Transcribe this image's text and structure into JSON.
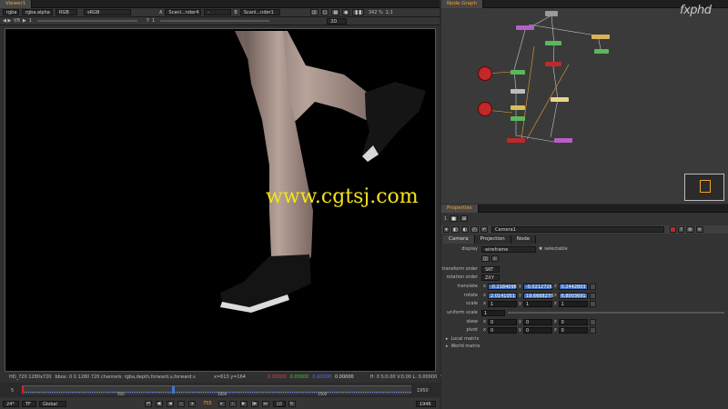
{
  "viewer_tabs": [
    {
      "label": "Viewer1"
    }
  ],
  "nodegraph_tab": {
    "label": "Node Graph"
  },
  "properties_tab": {
    "label": "Properties"
  },
  "watermark_logo": "fxphd",
  "watermark_url": "www.cgtsj.com",
  "viewer_toolbar": {
    "channels": "rgba",
    "alpha": "rgba.alpha",
    "colorspace_mode": "RGB",
    "lut": "sRGB",
    "a_label": "A",
    "a_input": "Scanl...nder4",
    "ab_op": "-",
    "b_label": "B",
    "b_input": "Scanl...nder1",
    "zoom": "342 %",
    "ratio": "1:1"
  },
  "viewer_toolbar2": {
    "fstop": "f/8",
    "frame_field": "1",
    "y_label": "Y",
    "y_value": "1",
    "gain_field": "2D"
  },
  "status_bar": {
    "format": "HD_720 1280x720",
    "bbox": "bbox: 0 0 1280 720 channels: rgba,depth,forward.u,forward.v",
    "coords": "x=613 y=164",
    "r": "0.00000",
    "g": "0.00000",
    "b": "0.00000",
    "a": "0.00000",
    "hsvl": "H: 0 S:0.00 V:0.00  L: 0.00000"
  },
  "timeline": {
    "start": "5",
    "end": "1950",
    "ticks": [
      "500",
      "1000",
      "1500"
    ],
    "fps": "24*",
    "tf": "TF",
    "scope": "Global",
    "current_frame": "755",
    "step": "10",
    "end_field": "1946"
  },
  "properties": {
    "node_name": "Camera1",
    "tabs": [
      "Camera",
      "Projection",
      "Node"
    ],
    "display_label": "display",
    "display_value": "wireframe",
    "selectable_label": "selectable",
    "transform_order_label": "transform order",
    "transform_order_value": "SRT",
    "rotation_order_label": "rotation order",
    "rotation_order_value": "ZXY",
    "translate_label": "translate",
    "translate": {
      "x": "-0.2184098",
      "y": "-0.0212726",
      "z": "0.2442803"
    },
    "rotate_label": "rotate",
    "rotate": {
      "x": "2.0141051",
      "y": "19.6668278",
      "z": "6.8003691"
    },
    "scale_label": "scale",
    "scale": {
      "x": "1",
      "y": "1",
      "z": "1"
    },
    "uniform_scale_label": "uniform scale",
    "uniform_scale_value": "1",
    "skew_label": "skew",
    "skew": {
      "x": "0",
      "y": "0",
      "z": "0"
    },
    "pivot_label": "pivot",
    "pivot": {
      "x": "0",
      "y": "0",
      "z": "0"
    },
    "local_matrix_label": "Local matrix",
    "world_matrix_label": "World matrix"
  },
  "colors": {
    "accent": "#f0a030",
    "selection": "#3f6fbf",
    "node_red": "#c0282a"
  },
  "icons": [
    "close-icon",
    "settings-icon",
    "camera-icon",
    "play-icon",
    "scroll-arrow-icon"
  ]
}
